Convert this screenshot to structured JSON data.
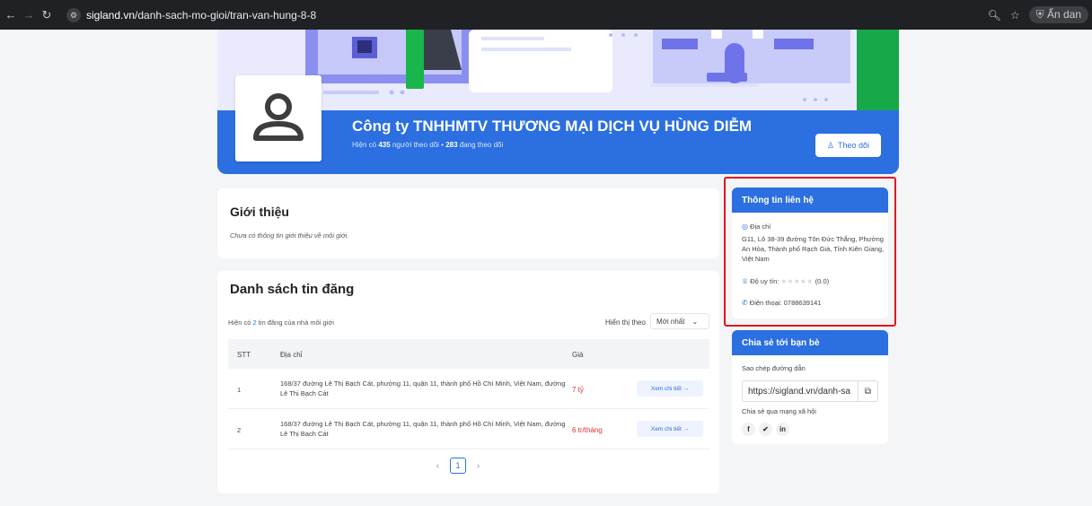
{
  "browser": {
    "url_host": "sigland.vn",
    "url_path": "/danh-sach-mo-gioi/tran-van-hung-8-8",
    "incognito_label": "Ẩn dan"
  },
  "profile": {
    "company_name": "Công ty TNHHMTV THƯƠNG MẠI DỊCH VỤ HÙNG DIỄM",
    "followers_prefix": "Hiện có",
    "followers_count": "435",
    "followers_text": "người theo dõi •",
    "following_count": "283",
    "following_text": "đang theo dõi",
    "follow_button": "Theo dõi"
  },
  "intro": {
    "title": "Giới thiệu",
    "text": "Chưa có thông tin giới thiệu về môi giới."
  },
  "listings": {
    "title": "Danh sách tin đăng",
    "count_prefix": "Hiện có",
    "count": "2",
    "count_suffix": "tin đăng của nhà môi giới",
    "sort_label": "Hiển thị theo",
    "sort_value": "Mới nhất",
    "columns": {
      "stt": "STT",
      "address": "Địa chỉ",
      "price": "Giá"
    },
    "rows": [
      {
        "stt": "1",
        "address": "168/37 đường Lê Thị Bạch Cát, phường 11, quận 11, thành phố Hồ Chí Minh, Việt Nam, đường Lê Thị Bạch Cát",
        "price": "7 tỷ",
        "action": "Xem chi tiết →"
      },
      {
        "stt": "2",
        "address": "168/37 đường Lê Thị Bạch Cát, phường 11, quận 11, thành phố Hồ Chí Minh, Việt Nam, đường Lê Thị Bạch Cát",
        "price": "6 tr/tháng",
        "action": "Xem chi tiết →"
      }
    ],
    "current_page": "1"
  },
  "contact": {
    "title": "Thông tin liên hệ",
    "address_label": "Địa chỉ",
    "address": "G11, Lô 38-39 đường Tôn Đức Thắng, Phường An Hòa, Thành phố Rạch Giá, Tỉnh Kiên Giang, Việt Nam",
    "reputation_label": "Độ uy tín:",
    "reputation_value": "(0.0)",
    "phone_label": "Điện thoại:",
    "phone": "0788639141"
  },
  "share": {
    "title": "Chia sẻ tới bạn bè",
    "copy_label": "Sao chép đường dẫn",
    "link": "https://sigland.vn/danh-sa",
    "social_label": "Chia sẻ qua mạng xã hội"
  },
  "colors": {
    "brand_blue": "#2b6fe0",
    "price_red": "#e22c2c",
    "highlight_red": "#e0161f"
  }
}
